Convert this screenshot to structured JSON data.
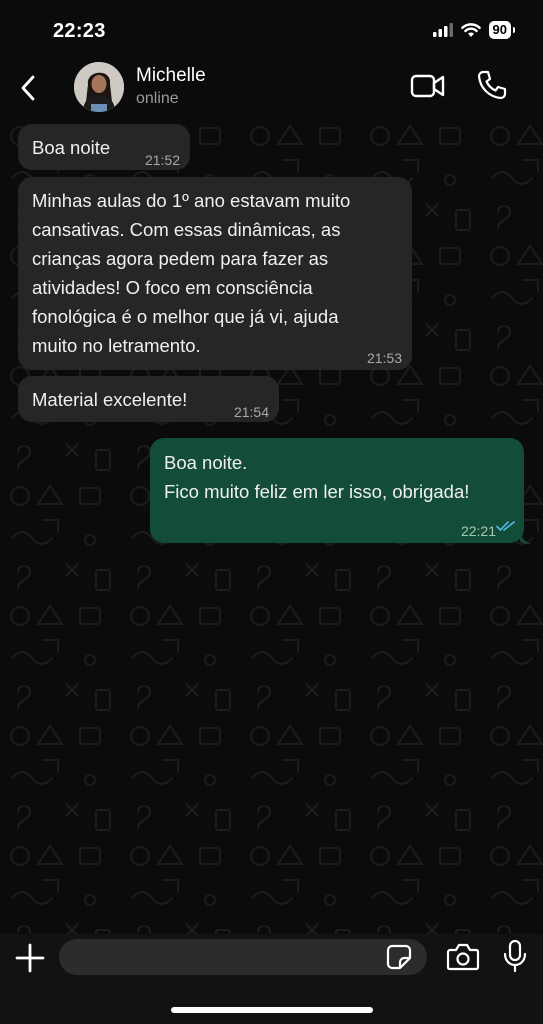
{
  "status_bar": {
    "time": "22:23",
    "battery": "90"
  },
  "header": {
    "contact_name": "Michelle",
    "contact_status": "online"
  },
  "messages": [
    {
      "direction": "in",
      "text": "Boa noite",
      "time": "21:52"
    },
    {
      "direction": "in",
      "text": "Minhas aulas do 1º ano estavam muito\ncansativas. Com essas dinâmicas, as\ncrianças agora pedem para fazer as\natividades! O foco em consciência\nfonológica é o melhor que já vi, ajuda\nmuito no letramento.",
      "time": "21:53"
    },
    {
      "direction": "in",
      "text": "Material excelente!",
      "time": "21:54"
    },
    {
      "direction": "out",
      "text": "Boa noite.\nFico muito feliz em ler isso, obrigada!",
      "time": "22:21",
      "status": "read"
    }
  ],
  "composer": {
    "value": "",
    "placeholder": ""
  },
  "colors": {
    "incoming_bubble": "#262626",
    "outgoing_bubble": "#144d37",
    "read_ticks": "#53bdeb",
    "background": "#0b0b0b"
  },
  "icons": [
    "signal-icon",
    "wifi-icon",
    "battery-icon",
    "back-chevron-icon",
    "video-call-icon",
    "phone-call-icon",
    "plus-icon",
    "sticker-icon",
    "camera-icon",
    "microphone-icon",
    "double-check-icon"
  ]
}
